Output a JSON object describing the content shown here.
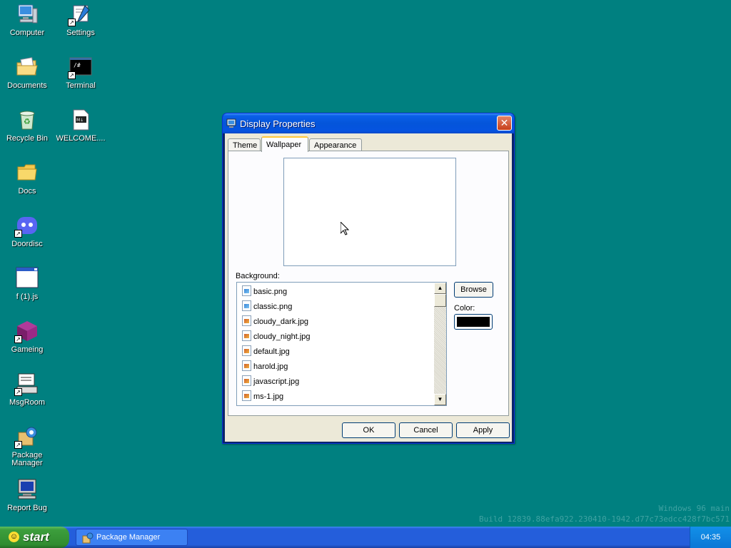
{
  "desktop": {
    "icons": [
      {
        "label": "Computer",
        "icon": "computer-icon"
      },
      {
        "label": "Settings",
        "icon": "settings-icon"
      },
      {
        "label": "Documents",
        "icon": "documents-icon"
      },
      {
        "label": "Terminal",
        "icon": "terminal-icon"
      },
      {
        "label": "Recycle Bin",
        "icon": "recycle-bin-icon"
      },
      {
        "label": "WELCOME....",
        "icon": "markdown-file-icon"
      },
      {
        "label": "Docs",
        "icon": "folder-icon"
      },
      {
        "label": "Doordisc",
        "icon": "doordisc-icon"
      },
      {
        "label": "f (1).js",
        "icon": "window-file-icon"
      },
      {
        "label": "Gameing",
        "icon": "game-cube-icon"
      },
      {
        "label": "MsgRoom",
        "icon": "msgroom-icon"
      },
      {
        "label": "Package Manager",
        "icon": "package-manager-icon"
      },
      {
        "label": "Report Bug",
        "icon": "report-bug-icon"
      }
    ]
  },
  "dialog": {
    "title": "Display Properties",
    "close_label": "✕",
    "tabs": [
      {
        "label": "Theme",
        "active": false
      },
      {
        "label": "Wallpaper",
        "active": true
      },
      {
        "label": "Appearance",
        "active": false
      }
    ],
    "background_label": "Background:",
    "backgrounds": [
      {
        "name": "basic.png",
        "type": "png"
      },
      {
        "name": "classic.png",
        "type": "png"
      },
      {
        "name": "cloudy_dark.jpg",
        "type": "jpg"
      },
      {
        "name": "cloudy_night.jpg",
        "type": "jpg"
      },
      {
        "name": "default.jpg",
        "type": "jpg"
      },
      {
        "name": "harold.jpg",
        "type": "jpg"
      },
      {
        "name": "javascript.jpg",
        "type": "jpg"
      },
      {
        "name": "ms-1.jpg",
        "type": "jpg"
      }
    ],
    "browse_label": "Browse",
    "color_label": "Color:",
    "color_value": "#000000",
    "ok_label": "OK",
    "cancel_label": "Cancel",
    "apply_label": "Apply"
  },
  "watermark": {
    "line1": "Windows 96 main",
    "line2": "Build 12839.88efa922.230410-1942.d77c73edcc428f7bc571"
  },
  "taskbar": {
    "start_label": "start",
    "tasks": [
      {
        "label": "Package Manager",
        "icon": "package-manager-icon"
      }
    ],
    "clock": "04:35"
  },
  "colors": {
    "desktop": "#008080",
    "titlebar": "#0455da",
    "taskbar": "#245edb",
    "start": "#308c30"
  }
}
